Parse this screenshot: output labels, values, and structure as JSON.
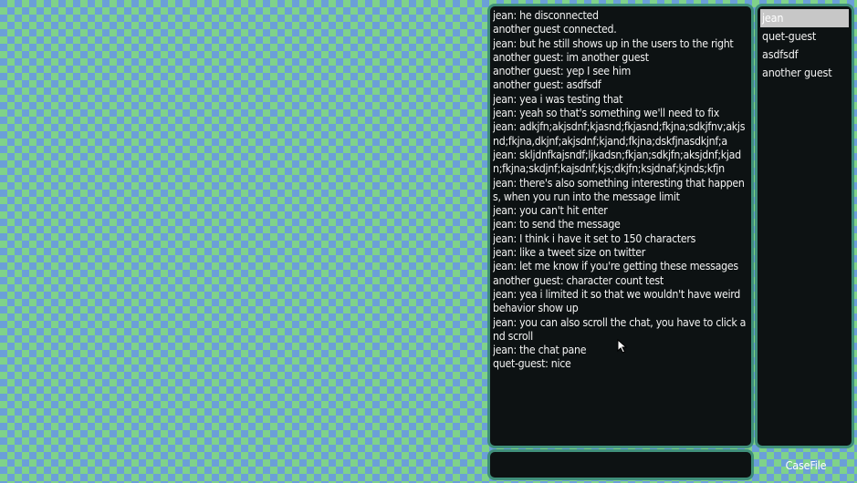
{
  "chat": {
    "messages": [
      "jean: he disconnected",
      "another guest connected.",
      "jean: but he still shows up in the users to the right",
      "another guest: im another guest",
      "another guest: yep I see him",
      "another guest: asdfsdf",
      "jean: yea i was testing that",
      "jean: yeah so that's something we'll need to fix",
      "jean: adkjfn;akjsdnf;kjasnd;fkjasnd;fkjna;sdkjfnv;akjsnd;fkjna,dkjnf;akjsdnf;kjand;fkjna;dskfjnasdkjnf;a",
      "jean: skljdnfkajsndf;ljkadsn;fkjan;sdkjfn;aksjdnf;kjadn;fkjna;skdjnf;kajsdnf;kjs;dkjfn;ksjdnaf;kjnds;kfjn",
      "jean: there's also something interesting that happens, when you run into the message limit",
      "jean: you can't hit enter",
      "jean: to send the message",
      "jean: I think i have it set to 150 characters",
      "jean: like a tweet size on twitter",
      "jean: let me know if you're getting these messages",
      "another guest: character count test",
      "jean: yea i limited it so that we wouldn't have weird behavior show up",
      "jean: you can also scroll the chat, you have to click and scroll",
      "jean: the chat pane",
      "quet-guest: nice"
    ]
  },
  "users": {
    "items": [
      {
        "name": "jean",
        "selected": true
      },
      {
        "name": "quet-guest",
        "selected": false
      },
      {
        "name": "asdfsdf",
        "selected": false
      },
      {
        "name": "another guest",
        "selected": false
      }
    ]
  },
  "input": {
    "value": "",
    "placeholder": ""
  },
  "footer": {
    "casefile_label": "CaseFile"
  },
  "colors": {
    "background_blue": "#6b9fd8",
    "background_green": "#7fd28a",
    "panel_background": "#0d1213",
    "panel_border": "#3f8f7a",
    "selection": "#c7c7c7",
    "text": "#f2f2f2"
  },
  "icons": {
    "mouse_cursor": "mouse-cursor-icon"
  }
}
